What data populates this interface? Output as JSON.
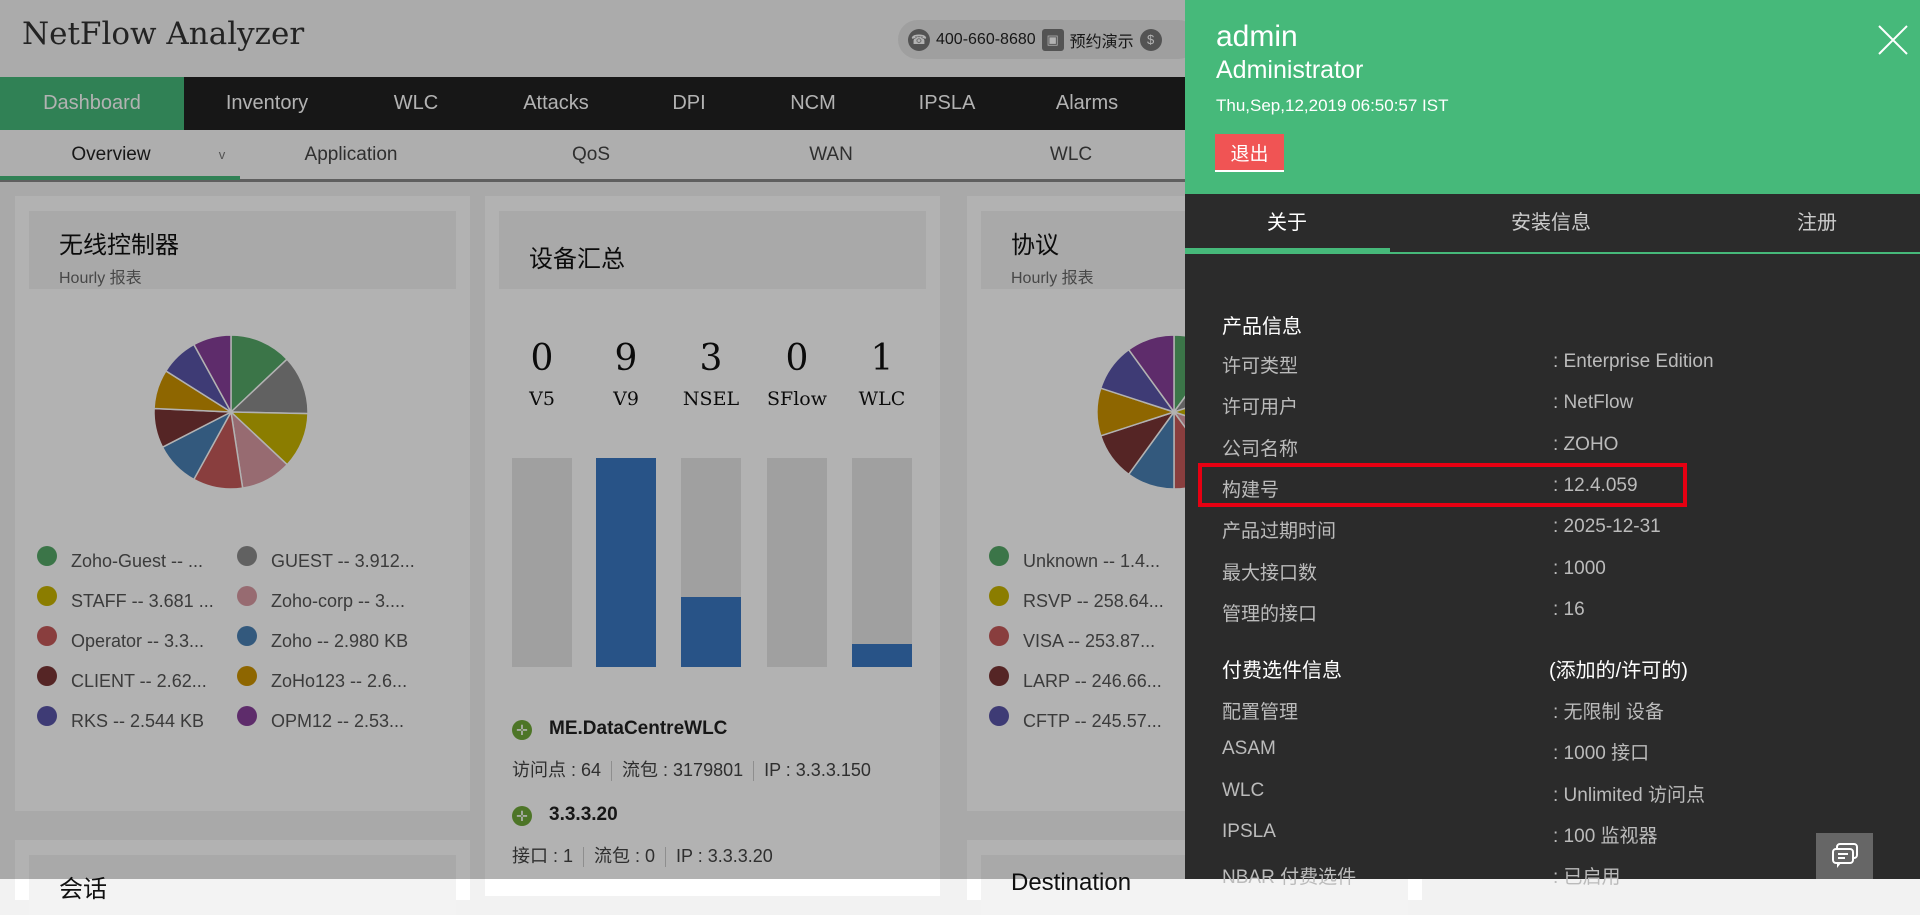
{
  "header": {
    "title": "NetFlow Analyzer",
    "phone": "400-660-8680",
    "demo": "预约演示"
  },
  "nav": {
    "items": [
      "Dashboard",
      "Inventory",
      "WLC",
      "Attacks",
      "DPI",
      "NCM",
      "IPSLA",
      "Alarms"
    ]
  },
  "subnav": {
    "items": [
      "Overview",
      "Application",
      "QoS",
      "WAN",
      "WLC"
    ]
  },
  "wlc_card": {
    "title": "无线控制器",
    "subtitle": "Hourly 报表",
    "legend": [
      {
        "label": "Zoho-Guest -- ...",
        "color": "#55a868",
        "value": 4.1
      },
      {
        "label": "GUEST -- 3.912...",
        "color": "#8c8c8c",
        "value": 3.912
      },
      {
        "label": "STAFF -- 3.681 ...",
        "color": "#c8b400",
        "value": 3.681
      },
      {
        "label": "Zoho-corp -- 3....",
        "color": "#d89aa3",
        "value": 3.35
      },
      {
        "label": "Operator -- 3.3...",
        "color": "#c55a5a",
        "value": 3.3
      },
      {
        "label": "Zoho -- 2.980 KB",
        "color": "#4a80b4",
        "value": 2.98
      },
      {
        "label": "CLIENT -- 2.62...",
        "color": "#7a3535",
        "value": 2.62
      },
      {
        "label": "ZoHo123 -- 2.6...",
        "color": "#cc9200",
        "value": 2.6
      },
      {
        "label": "RKS -- 2.544 KB",
        "color": "#5a55a8",
        "value": 2.544
      },
      {
        "label": "OPM12 -- 2.53...",
        "color": "#87409a",
        "value": 2.53
      }
    ]
  },
  "device_card": {
    "title": "设备汇总",
    "counts": [
      {
        "value": "0",
        "label": "V5"
      },
      {
        "value": "9",
        "label": "V9"
      },
      {
        "value": "3",
        "label": "NSEL"
      },
      {
        "value": "0",
        "label": "SFlow"
      },
      {
        "value": "1",
        "label": "WLC"
      }
    ],
    "devices": [
      {
        "name": "ME.DataCentreWLC",
        "meta": [
          "访问点 : 64",
          "流包 : 3179801",
          "IP : 3.3.3.150"
        ]
      },
      {
        "name": "3.3.3.20",
        "meta": [
          "接口 : 1",
          "流包 : 0",
          "IP : 3.3.3.20"
        ]
      }
    ]
  },
  "protocol_card": {
    "title": "协议",
    "subtitle": "Hourly 报表",
    "legend": [
      {
        "label": "Unknown -- 1.4...",
        "color": "#55a868"
      },
      {
        "label": "RSVP -- 258.64...",
        "color": "#c8b400"
      },
      {
        "label": "VISA -- 253.87...",
        "color": "#c55a5a"
      },
      {
        "label": "LARP -- 246.66...",
        "color": "#7a3535"
      },
      {
        "label": "CFTP -- 245.57...",
        "color": "#5a55a8"
      }
    ]
  },
  "row2": {
    "session_title": "会话",
    "destination_title": "Destination"
  },
  "panel": {
    "user": "admin",
    "role": "Administrator",
    "datetime": "Thu,Sep,12,2019 06:50:57 IST",
    "logout": "退出",
    "tabs": [
      "关于",
      "安装信息",
      "注册"
    ],
    "product_title": "产品信息",
    "product_rows": [
      {
        "label": "许可类型",
        "value": ": Enterprise Edition"
      },
      {
        "label": "许可用户",
        "value": ": NetFlow"
      },
      {
        "label": "公司名称",
        "value": ": ZOHO"
      },
      {
        "label": "构建号",
        "value": ": 12.4.059"
      },
      {
        "label": "产品过期时间",
        "value": ": 2025-12-31"
      },
      {
        "label": "最大接口数",
        "value": ": 1000"
      },
      {
        "label": "管理的接口",
        "value": ": 16"
      }
    ],
    "addon_title": "付费选件信息",
    "addon_header": "(添加的/许可的)",
    "addon_rows": [
      {
        "label": "配置管理",
        "value": ": 无限制 设备"
      },
      {
        "label": "ASAM",
        "value": ": 1000 接口"
      },
      {
        "label": "WLC",
        "value": ": Unlimited 访问点"
      },
      {
        "label": "IPSLA",
        "value": ": 100 监视器"
      },
      {
        "label": "NBAR 付费选件",
        "value": ": 已启用"
      }
    ]
  }
}
